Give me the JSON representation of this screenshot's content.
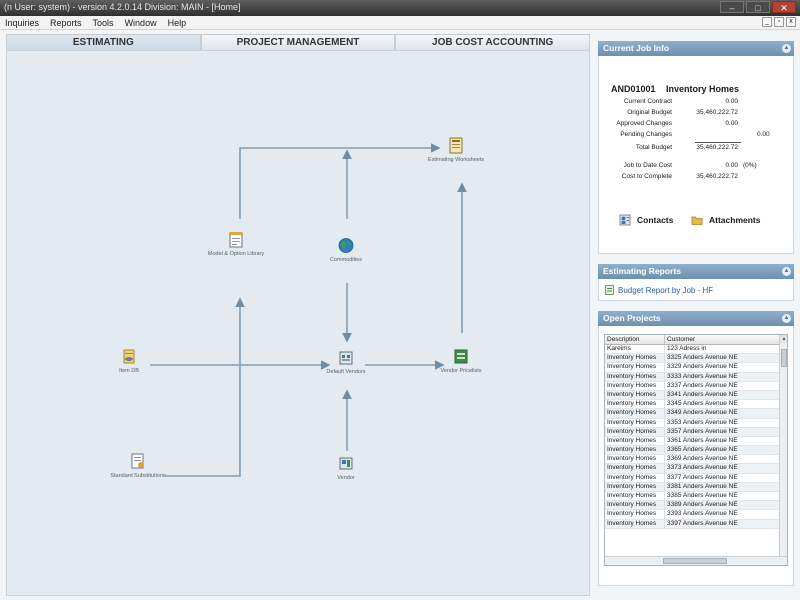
{
  "window": {
    "title": "(n User: system) - version 4.2.0.14 Division: MAIN - [Home]",
    "minimize": "–",
    "maximize": "□",
    "close": "✕"
  },
  "menu": [
    "Inquiries",
    "Reports",
    "Tools",
    "Window",
    "Help"
  ],
  "mdi": {
    "minimize": "_",
    "restore": "▫",
    "close": "x"
  },
  "tabs": [
    "ESTIMATING",
    "PROJECT MANAGEMENT",
    "JOB COST ACCOUNTING"
  ],
  "active_tab": "ESTIMATING",
  "workflow": {
    "nodes": {
      "worksheets": {
        "label": "Estimating Worksheets",
        "icon": "worksheet-icon"
      },
      "model_library": {
        "label": "Model & Option Library",
        "icon": "notepad-icon"
      },
      "commodities": {
        "label": "Commodities",
        "icon": "globe-icon"
      },
      "item_db": {
        "label": "Item DB",
        "icon": "item-db-icon"
      },
      "default_vendors": {
        "label": "Default Vendors",
        "icon": "vendors-icon"
      },
      "vendor_pricelists": {
        "label": "Vendor Pricelists",
        "icon": "pricelist-icon"
      },
      "std_substitutions": {
        "label": "Standard Substitutions",
        "icon": "substitution-icon"
      },
      "vendor": {
        "label": "Vendor",
        "icon": "vendor-icon"
      }
    }
  },
  "current_job": {
    "header": "Current Job Info",
    "code": "AND01001",
    "name": "Inventory Homes",
    "rows": [
      {
        "label": "Current Contract",
        "value": "0.00"
      },
      {
        "label": "Original Budget",
        "value": "35,460,222.72"
      },
      {
        "label": "Approved Changes",
        "value": "0.00"
      },
      {
        "label": "Pending Changes",
        "value": "",
        "extra": "0.00"
      },
      {
        "label": "Total Budget",
        "value": "35,460,222.72"
      },
      {
        "label": "Job to Date Cost",
        "value": "0.00",
        "pct": "(0%)"
      },
      {
        "label": "Cost to Complete",
        "value": "35,460,222.72"
      }
    ],
    "contacts": "Contacts",
    "attachments": "Attachments"
  },
  "estimating_reports": {
    "header": "Estimating Reports",
    "items": [
      "Budget Report by Job - HF"
    ]
  },
  "open_projects": {
    "header": "Open Projects",
    "columns": [
      "Description",
      "Customer"
    ],
    "rows": [
      [
        "Kareims",
        "123 Adress in"
      ],
      [
        "Inventory Homes",
        "3325 Anders Avenue NE"
      ],
      [
        "Inventory Homes",
        "3329 Anders Avenue NE"
      ],
      [
        "Inventory Homes",
        "3333 Anders Avenue NE"
      ],
      [
        "Inventory Homes",
        "3337 Anders Avenue NE"
      ],
      [
        "Inventory Homes",
        "3341 Anders Avenue NE"
      ],
      [
        "Inventory Homes",
        "3345 Anders Avenue NE"
      ],
      [
        "Inventory Homes",
        "3349 Anders Avenue NE"
      ],
      [
        "Inventory Homes",
        "3353 Anders Avenue NE"
      ],
      [
        "Inventory Homes",
        "3357 Anders Avenue NE"
      ],
      [
        "Inventory Homes",
        "3361 Anders Avenue NE"
      ],
      [
        "Inventory Homes",
        "3365 Anders Avenue NE"
      ],
      [
        "Inventory Homes",
        "3369 Anders Avenue NE"
      ],
      [
        "Inventory Homes",
        "3373 Anders Avenue NE"
      ],
      [
        "Inventory Homes",
        "3377 Anders Avenue NE"
      ],
      [
        "Inventory Homes",
        "3381 Anders Avenue NE"
      ],
      [
        "Inventory Homes",
        "3385 Anders Avenue NE"
      ],
      [
        "Inventory Homes",
        "3389 Anders Avenue NE"
      ],
      [
        "Inventory Homes",
        "3393 Anders Avenue NE"
      ],
      [
        "Inventory Homes",
        "3397 Anders Avenue NE"
      ]
    ]
  },
  "colors": {
    "panel_header": "#7b9dba",
    "canvas_bg": "#e3ebf0",
    "connector": "#6f8ea6",
    "link": "#2a5f9e"
  }
}
